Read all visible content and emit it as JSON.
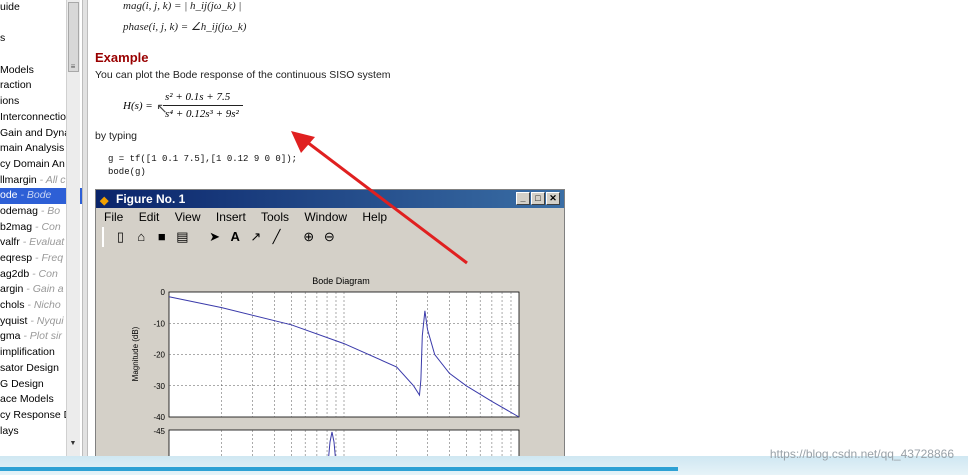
{
  "nav": {
    "items": [
      {
        "label": "uide",
        "sub": ""
      },
      {
        "label": "",
        "sub": ""
      },
      {
        "label": "s",
        "sub": ""
      },
      {
        "label": "",
        "sub": ""
      },
      {
        "label": "Models",
        "sub": ""
      },
      {
        "label": "raction",
        "sub": ""
      },
      {
        "label": "ions",
        "sub": ""
      },
      {
        "label": "Interconnection",
        "sub": ""
      },
      {
        "label": "Gain and Dyna",
        "sub": ""
      },
      {
        "label": "main Analysis",
        "sub": ""
      },
      {
        "label": "cy Domain An",
        "sub": ""
      },
      {
        "label": "llmargin",
        "sub": " - All c"
      },
      {
        "label": "ode",
        "sub": " - Bode",
        "selected": true
      },
      {
        "label": "odemag",
        "sub": " - Bo"
      },
      {
        "label": "b2mag",
        "sub": " - Con"
      },
      {
        "label": "valfr",
        "sub": " - Evaluat"
      },
      {
        "label": "eqresp",
        "sub": " - Freq"
      },
      {
        "label": "ag2db",
        "sub": " - Con"
      },
      {
        "label": "argin",
        "sub": " - Gain a"
      },
      {
        "label": "chols",
        "sub": " - Nicho"
      },
      {
        "label": "yquist",
        "sub": " - Nyqui"
      },
      {
        "label": "gma",
        "sub": " - Plot sir"
      },
      {
        "label": "implification",
        "sub": ""
      },
      {
        "label": "sator Design",
        "sub": ""
      },
      {
        "label": "G Design",
        "sub": ""
      },
      {
        "label": "ace Models",
        "sub": ""
      },
      {
        "label": "cy Response D",
        "sub": ""
      },
      {
        "label": "lays",
        "sub": ""
      }
    ]
  },
  "doc": {
    "eq_mag": "mag(i, j, k) = | h_ij(jω_k) |",
    "eq_phase": "phase(i, j, k) = ∠h_ij(jω_k)",
    "example_heading": "Example",
    "example_text": "You can plot the Bode response of the continuous SISO system",
    "tf_lhs": "H(s) =",
    "tf_num": "s² + 0.1s + 7.5",
    "tf_den": "s⁴ + 0.12s³ + 9s²",
    "typing_text": "by typing",
    "code_line1": "g = tf([1 0.1 7.5],[1 0.12 9 0 0]);",
    "code_line2": "bode(g)"
  },
  "figure": {
    "title": "Figure No. 1",
    "menu": [
      "File",
      "Edit",
      "View",
      "Insert",
      "Tools",
      "Window",
      "Help"
    ],
    "toolbar_icons": [
      "new-file-icon",
      "open-folder-icon",
      "save-icon",
      "print-icon",
      "pointer-icon",
      "text-icon",
      "arrow-icon",
      "line-icon",
      "zoom-in-icon",
      "zoom-out-icon",
      "rotate-icon"
    ]
  },
  "chart_data": {
    "type": "line",
    "title": "Bode Diagram",
    "xlabel": "",
    "ylabel": "Magnitude (dB)",
    "yticks": [
      "0",
      "-10",
      "-20",
      "-30",
      "-40"
    ],
    "ylim": [
      -40,
      0
    ],
    "xscale": "log",
    "grid": true,
    "series": [
      {
        "name": "",
        "x": [
          0.1,
          0.2,
          0.5,
          1.0,
          2.0,
          2.5,
          2.7,
          2.75,
          2.8,
          2.9,
          3.0,
          3.3,
          4.0,
          5.0,
          7.0,
          10.0
        ],
        "values": [
          -1.5,
          -5,
          -10.5,
          -16.5,
          -24,
          -30,
          -33,
          -28,
          -14,
          -6,
          -12,
          -20,
          -26,
          -30,
          -35,
          -40
        ]
      }
    ],
    "phase_ytick_top": "-45",
    "phase_color": "#3a3aaa"
  },
  "overlay": {
    "arrow_color": "#e02020",
    "watermark": "https://blog.csdn.net/qq_43728866"
  },
  "progress": {
    "fraction": 0.7
  }
}
